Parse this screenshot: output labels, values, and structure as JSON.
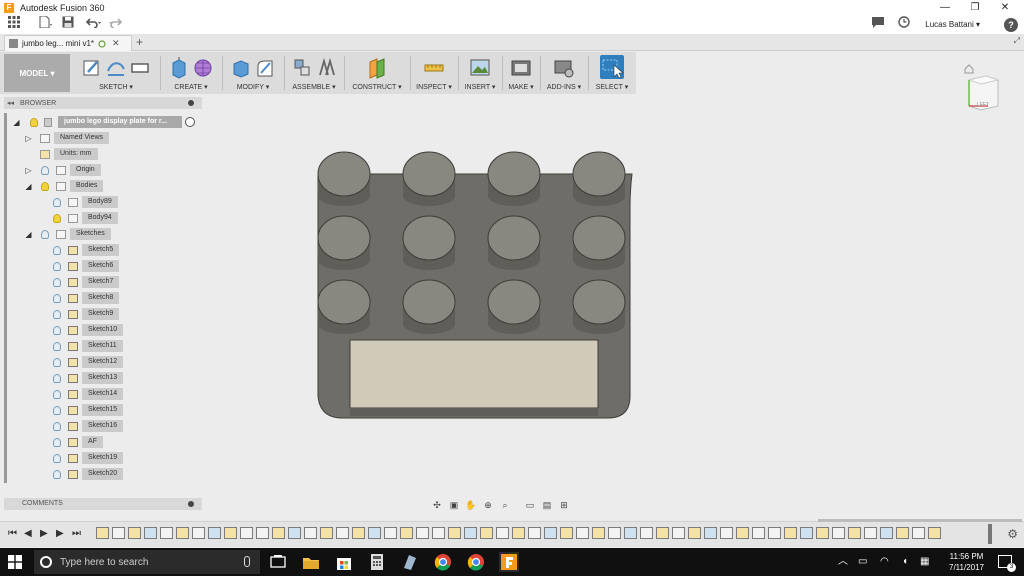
{
  "window": {
    "title": "Autodesk Fusion 360",
    "controls": {
      "minimize": "—",
      "restore": "❐",
      "close": "✕"
    }
  },
  "quick_access": {
    "user": "Lucas Battani ▾",
    "help": "?"
  },
  "document_tab": {
    "name": "jumbo leg... mini v1*",
    "close": "✕",
    "new_tab": "+"
  },
  "ribbon": {
    "workspace": "MODEL ▾",
    "groups": [
      {
        "label": "SKETCH ▾"
      },
      {
        "label": "CREATE ▾"
      },
      {
        "label": "MODIFY ▾"
      },
      {
        "label": "ASSEMBLE ▾"
      },
      {
        "label": "CONSTRUCT ▾"
      },
      {
        "label": "INSPECT ▾"
      },
      {
        "label": "INSERT ▾"
      },
      {
        "label": "MAKE ▾"
      },
      {
        "label": "ADD-INS ▾"
      },
      {
        "label": "SELECT ▾"
      }
    ]
  },
  "browser": {
    "title": "BROWSER",
    "root": "jumbo lego display plate for r...",
    "items": [
      {
        "label": "Named Views"
      },
      {
        "label": "Units: mm"
      },
      {
        "label": "Origin"
      },
      {
        "label": "Bodies"
      },
      {
        "label": "Body89"
      },
      {
        "label": "Body94"
      },
      {
        "label": "Sketches"
      },
      {
        "label": "Sketch5"
      },
      {
        "label": "Sketch6"
      },
      {
        "label": "Sketch7"
      },
      {
        "label": "Sketch8"
      },
      {
        "label": "Sketch9"
      },
      {
        "label": "Sketch10"
      },
      {
        "label": "Sketch11"
      },
      {
        "label": "Sketch12"
      },
      {
        "label": "Sketch13"
      },
      {
        "label": "Sketch14"
      },
      {
        "label": "Sketch15"
      },
      {
        "label": "Sketch16"
      },
      {
        "label": "AF"
      },
      {
        "label": "Sketch19"
      },
      {
        "label": "Sketch20"
      }
    ]
  },
  "comments": {
    "title": "COMMENTS"
  },
  "viewcube": {
    "face": "LEFT"
  },
  "taskbar": {
    "search_placeholder": "Type here to search",
    "time": "11:56 PM",
    "date": "7/11/2017",
    "notifications": "3"
  },
  "colors": {
    "accent_blue": "#4c8bc7",
    "body_gray": "#6e6d68",
    "stud_top": "#888780",
    "panel_tan": "#d1cab8"
  }
}
